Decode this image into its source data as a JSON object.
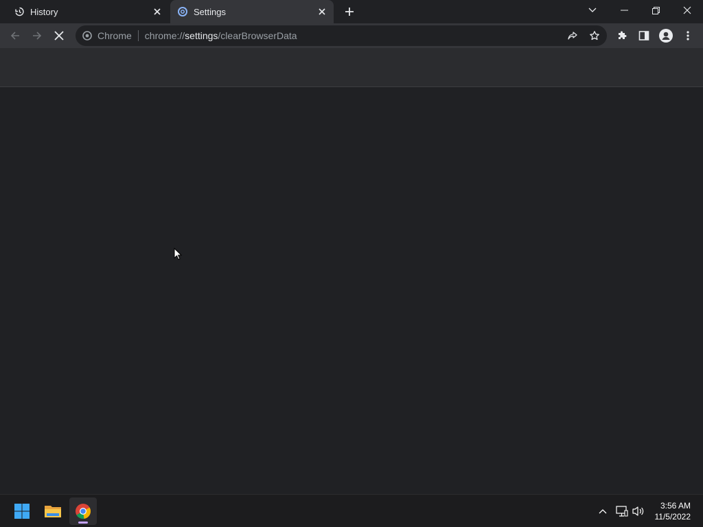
{
  "tabs": [
    {
      "title": "History",
      "icon": "history-icon",
      "active": false
    },
    {
      "title": "Settings",
      "icon": "settings-gear-icon",
      "active": true
    }
  ],
  "omnibox": {
    "chip": "Chrome",
    "url_scheme": "chrome://",
    "url_host": "settings",
    "url_path": "/clearBrowserData"
  },
  "taskbar": {
    "apps": [
      "windows-start-icon",
      "file-explorer-icon",
      "chrome-icon"
    ],
    "time": "3:56 AM",
    "date": "11/5/2022"
  },
  "colors": {
    "frame": "#202124",
    "toolbar": "#35363a",
    "page_header": "#2b2c2f",
    "accent_running": "#c5a3ff"
  }
}
